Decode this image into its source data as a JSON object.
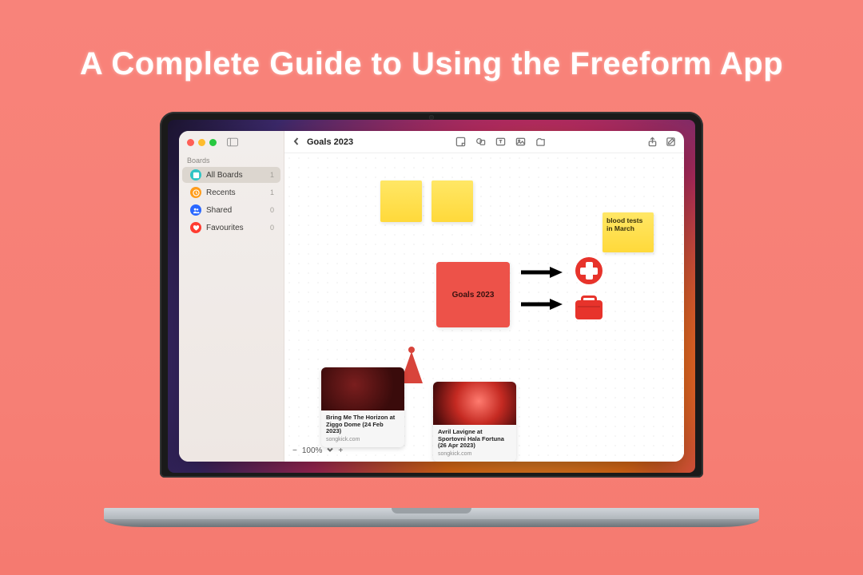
{
  "hero": {
    "title": "A Complete Guide to Using the Freeform App"
  },
  "sidebar": {
    "header": "Boards",
    "items": [
      {
        "label": "All Boards",
        "count": "1",
        "icon": "boards",
        "color": "teal",
        "selected": true
      },
      {
        "label": "Recents",
        "count": "1",
        "icon": "clock",
        "color": "orange",
        "selected": false
      },
      {
        "label": "Shared",
        "count": "0",
        "icon": "people",
        "color": "blue",
        "selected": false
      },
      {
        "label": "Favourites",
        "count": "0",
        "icon": "heart",
        "color": "red",
        "selected": false
      }
    ]
  },
  "toolbar": {
    "back_label": "Back",
    "board_title": "Goals 2023",
    "tools": [
      "sticky-note",
      "shape",
      "text",
      "media",
      "file"
    ],
    "right": [
      "share",
      "compose"
    ]
  },
  "canvas": {
    "red_square_label": "Goals 2023",
    "sticky_note_text": "blood tests in March",
    "link_cards": [
      {
        "title": "Bring Me The Horizon at Ziggo Dome (24 Feb 2023)",
        "source": "songkick.com"
      },
      {
        "title": "Avril Lavigne at Sportovni Hala Fortuna (26 Apr 2023)",
        "source": "songkick.com"
      }
    ]
  },
  "zoom": {
    "level": "100%"
  },
  "colors": {
    "accent_red": "#ed5249",
    "sticky_yellow": "#ffe766"
  }
}
